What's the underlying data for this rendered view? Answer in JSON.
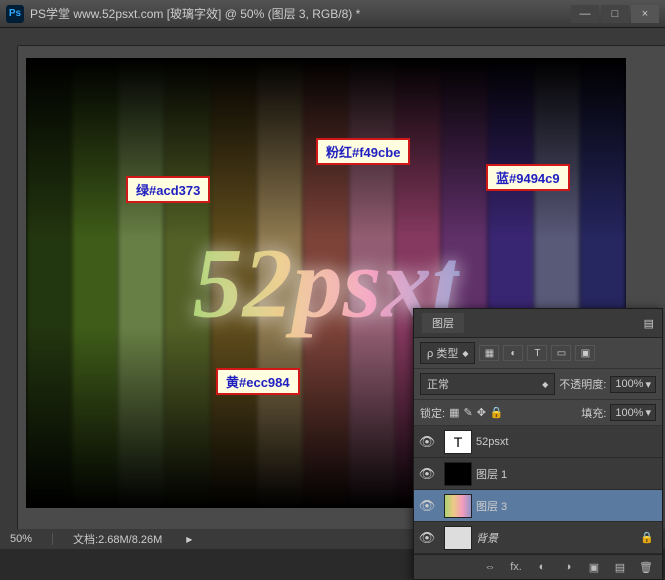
{
  "titlebar": {
    "ps_icon": "Ps",
    "title": "PS学堂 www.52psxt.com [玻璃字效] @ 50% (图层 3, RGB/8) *",
    "min": "—",
    "max": "□",
    "close": "×"
  },
  "canvas": {
    "main_text": "52psxt"
  },
  "annotations": {
    "green": "绿#acd373",
    "yellow": "黄#ecc984",
    "pink": "粉红#f49cbe",
    "blue": "蓝#9494c9"
  },
  "statusbar": {
    "zoom": "50%",
    "doc_info": "文档:2.68M/8.26M",
    "tri": "▶"
  },
  "layers": {
    "tab": "图层",
    "menu_icon": "▤",
    "kind_label": "ρ 类型",
    "kind_chev": "◆",
    "blend_mode": "正常",
    "blend_chev": "◆",
    "opacity_label": "不透明度:",
    "opacity_value": "100%",
    "lock_label": "锁定:",
    "fill_label": "填充:",
    "fill_value": "100%",
    "filter_icons": {
      "pixel": "▦",
      "adjust": "◐",
      "type": "T",
      "shape": "▭",
      "smart": "▣"
    },
    "lock_icons": {
      "trans": "▦",
      "paint": "✎",
      "pos": "✥",
      "all": "🔒"
    },
    "items": [
      {
        "eye": "👁",
        "thumb_type": "text",
        "thumb_label": "T",
        "name": "52psxt",
        "italic": false,
        "selected": false,
        "locked": false
      },
      {
        "eye": "👁",
        "thumb_type": "black",
        "thumb_label": "",
        "name": "图层 1",
        "italic": false,
        "selected": false,
        "locked": false
      },
      {
        "eye": "👁",
        "thumb_type": "rainbow",
        "thumb_label": "",
        "name": "图层 3",
        "italic": false,
        "selected": true,
        "locked": false
      },
      {
        "eye": "👁",
        "thumb_type": "lock",
        "thumb_label": "",
        "name": "背景",
        "italic": true,
        "selected": false,
        "locked": true
      }
    ],
    "bottom_icons": {
      "link": "⇔",
      "fx": "fx.",
      "mask": "◐",
      "fill": "◑",
      "group": "▣",
      "new": "▤",
      "trash": "🗑"
    }
  }
}
